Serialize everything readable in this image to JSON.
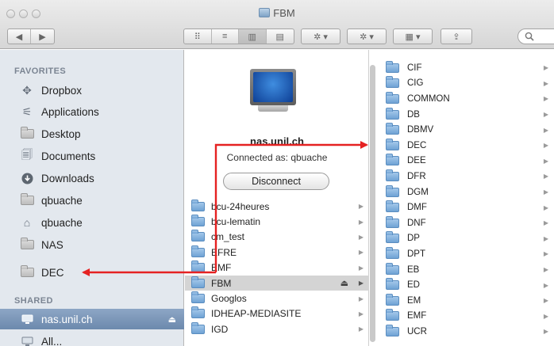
{
  "window": {
    "title": "FBM"
  },
  "toolbar": {
    "nav": [
      "◀",
      "▶"
    ],
    "views": [
      "⠿",
      "≡",
      "▥",
      "▤"
    ],
    "action": "✲ ▾",
    "share": "✲ ▾",
    "arrange": "▦ ▾",
    "export": "⇪",
    "search_icon": "magnifier"
  },
  "sidebar": {
    "favorites_header": "FAVORITES",
    "favorites": [
      {
        "label": "Dropbox",
        "icon": "dropbox-icon"
      },
      {
        "label": "Applications",
        "icon": "applications-icon"
      },
      {
        "label": "Desktop",
        "icon": "desktop-icon"
      },
      {
        "label": "Documents",
        "icon": "documents-icon"
      },
      {
        "label": "Downloads",
        "icon": "downloads-icon"
      },
      {
        "label": "qbuache",
        "icon": "folder-icon"
      },
      {
        "label": "qbuache",
        "icon": "home-icon"
      },
      {
        "label": "NAS",
        "icon": "folder-icon"
      },
      {
        "label": "DEC",
        "icon": "folder-icon"
      }
    ],
    "shared_header": "SHARED",
    "shared": [
      {
        "label": "nas.unil.ch",
        "icon": "server-icon",
        "selected": true
      },
      {
        "label": "All...",
        "icon": "network-icon"
      }
    ]
  },
  "server_info": {
    "name": "nas.unil.ch",
    "connected_as": "Connected as: qbuache",
    "disconnect_label": "Disconnect"
  },
  "column2": [
    "bcu-24heures",
    "bcu-lematin",
    "cm_test",
    "EFRE",
    "EMF",
    "FBM",
    "Googlos",
    "IDHEAP-MEDIASITE",
    "IGD"
  ],
  "column2_selected": "FBM",
  "column3": [
    "CIF",
    "CIG",
    "COMMON",
    "DB",
    "DBMV",
    "DEC",
    "DEE",
    "DFR",
    "DGM",
    "DMF",
    "DNF",
    "DP",
    "DPT",
    "EB",
    "ED",
    "EM",
    "EMF",
    "UCR"
  ],
  "colors": {
    "annotation": "#e52222",
    "selection": "#6c89ad"
  }
}
